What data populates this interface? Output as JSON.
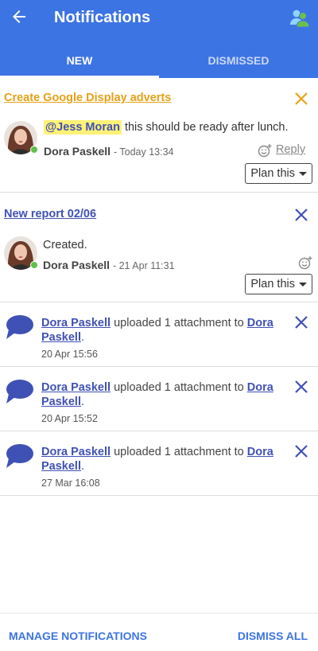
{
  "header": {
    "title": "Notifications",
    "tabs": [
      {
        "label": "NEW",
        "active": true
      },
      {
        "label": "DISMISSED",
        "active": false
      }
    ]
  },
  "colors": {
    "primary": "#3d74e3",
    "accent_orange": "#e6a117",
    "link_blue": "#3f51b5",
    "mention_highlight": "#fff176",
    "online": "#5cc24a"
  },
  "notifications": [
    {
      "title": "Create Google Display adverts",
      "mention": "@Jess Moran",
      "message": " this should be ready after lunch.",
      "author": "Dora Paskell",
      "time": "- Today 13:34",
      "reply_label": "Reply",
      "plan_label": "Plan this"
    },
    {
      "title": "New report 02/06",
      "message": "Created.",
      "author": "Dora Paskell",
      "time": "- 21 Apr 11:31",
      "plan_label": "Plan this"
    }
  ],
  "uploads": [
    {
      "user": "Dora Paskell",
      "action": " uploaded 1 attachment to ",
      "target": "Dora Paskell",
      "suffix": ".",
      "date": "20 Apr 15:56"
    },
    {
      "user": "Dora Paskell",
      "action": " uploaded 1 attachment to ",
      "target": "Dora Paskell",
      "suffix": ".",
      "date": "20 Apr 15:52"
    },
    {
      "user": "Dora Paskell",
      "action": " uploaded 1 attachment to ",
      "target": "Dora Paskell",
      "suffix": ".",
      "date": "27 Mar 16:08"
    }
  ],
  "footer": {
    "manage_label": "MANAGE NOTIFICATIONS",
    "dismiss_all_label": "DISMISS ALL"
  }
}
